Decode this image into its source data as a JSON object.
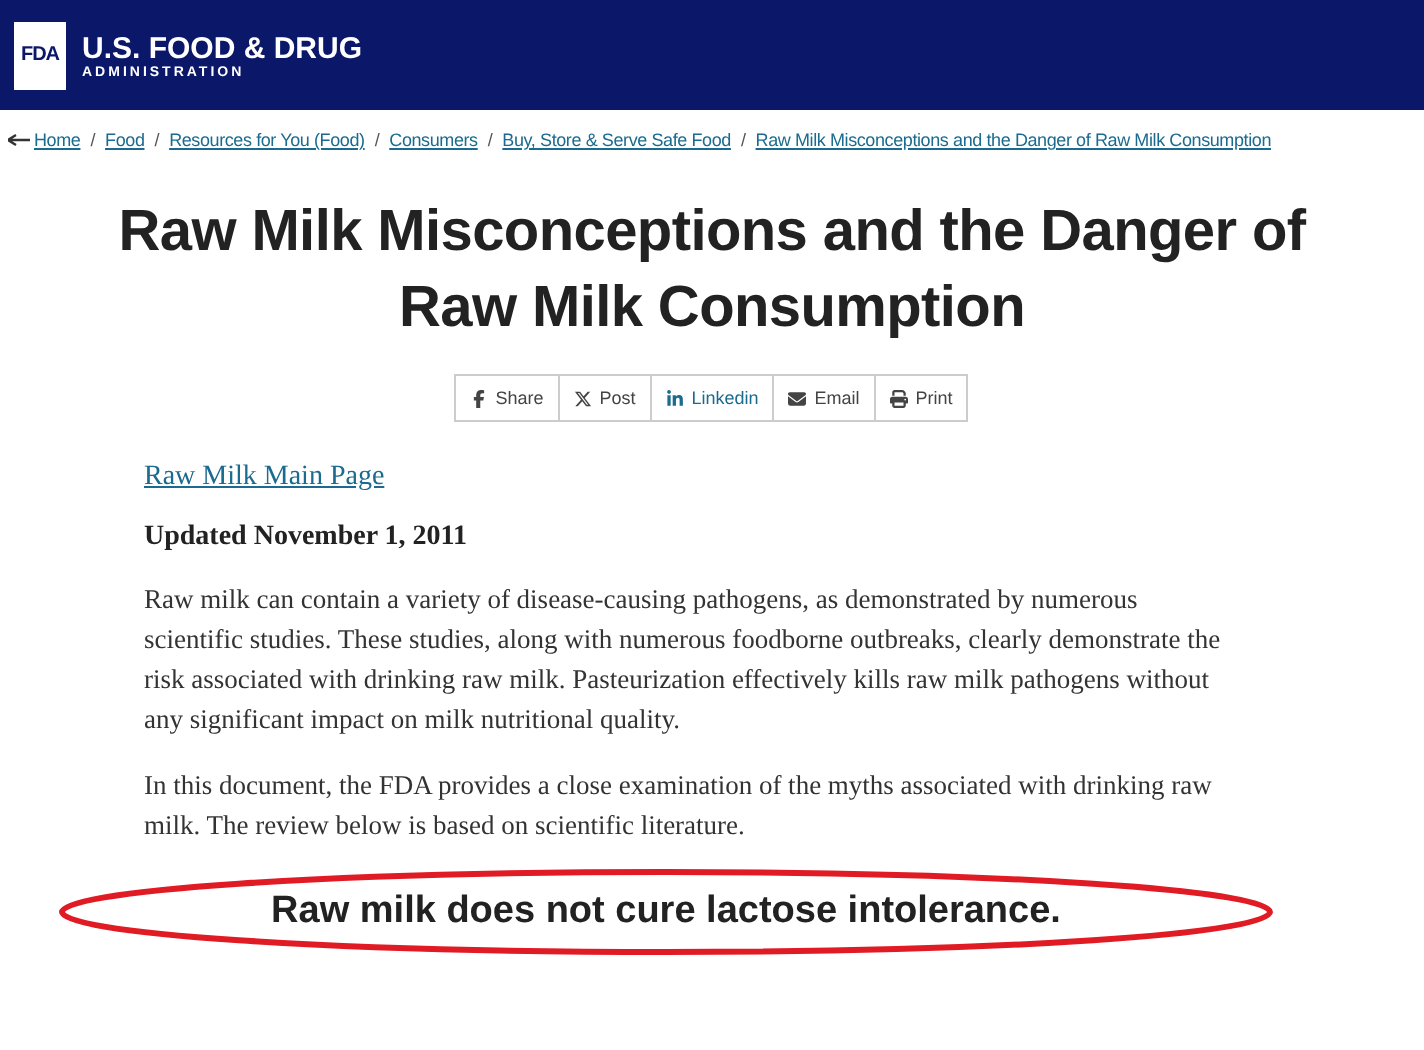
{
  "header": {
    "logo_text": "FDA",
    "title": "U.S. FOOD & DRUG",
    "subtitle": "ADMINISTRATION"
  },
  "breadcrumb": [
    "Home",
    "Food",
    "Resources for You (Food)",
    "Consumers",
    "Buy, Store & Serve Safe Food",
    "Raw Milk Misconceptions and the Danger of Raw Milk Consumption"
  ],
  "breadcrumb_separator": "/",
  "page_title": "Raw Milk Misconceptions and the Danger of Raw Milk Consumption",
  "share_buttons": [
    {
      "kind": "facebook",
      "label": "Share"
    },
    {
      "kind": "x",
      "label": "Post"
    },
    {
      "kind": "linkedin",
      "label": "Linkedin"
    },
    {
      "kind": "email",
      "label": "Email"
    },
    {
      "kind": "print",
      "label": "Print"
    }
  ],
  "main_page_link": "Raw Milk Main Page",
  "updated": "Updated November 1, 2011",
  "paragraphs": [
    "Raw milk can contain a variety of disease-causing pathogens, as demonstrated by numerous scientific studies. These studies, along with numerous foodborne outbreaks, clearly demonstrate the risk associated with drinking raw milk. Pasteurization effectively kills raw milk pathogens without any significant impact on milk nutritional quality.",
    "In this document, the FDA provides a close examination of the myths associated with drinking raw milk. The review below is based on scientific literature."
  ],
  "section_heading": {
    "text": "Raw milk does not cure lactose intolerance.",
    "circled": true
  }
}
